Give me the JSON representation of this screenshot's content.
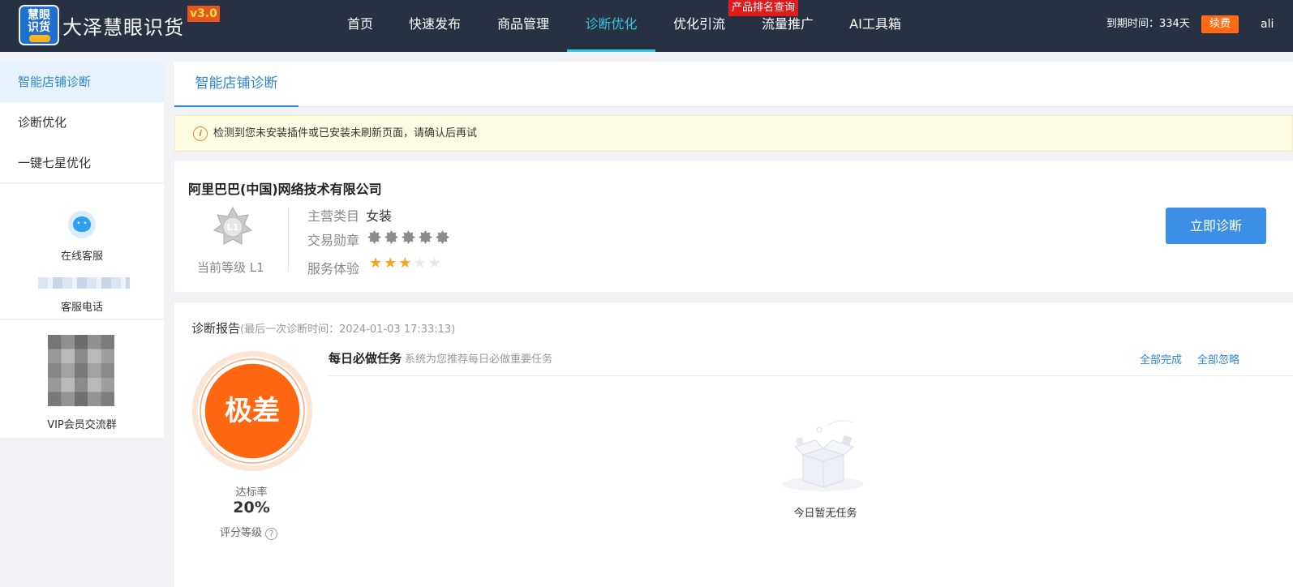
{
  "brand": {
    "logo_line1": "慧眼",
    "logo_line2": "识货",
    "name": "大泽慧眼识货",
    "version": "v3.0"
  },
  "nav": {
    "items": [
      "首页",
      "快速发布",
      "商品管理",
      "诊断优化",
      "优化引流",
      "流量推广",
      "AI工具箱"
    ],
    "active": "诊断优化",
    "hot_tag": "产品排名查询"
  },
  "account": {
    "expire": "到期时间：334天",
    "renew": "续费",
    "user": "ali"
  },
  "sidebar": {
    "items": [
      "智能店铺诊断",
      "诊断优化",
      "一键七星优化"
    ],
    "online_service": "在线客服",
    "service_phone": "客服电话",
    "vip_group": "VIP会员交流群"
  },
  "tab": {
    "label": "智能店铺诊断"
  },
  "alert": {
    "icon": "i",
    "text": "检测到您未安装插件或已安装未刷新页面，请确认后再试"
  },
  "shop": {
    "name": "阿里巴巴(中国)网络技术有限公司",
    "level_badge": "L1",
    "level_text": "当前等级 L1",
    "category_label": "主营类目",
    "category_value": "女装",
    "medal_label": "交易勋章",
    "medal_count": 5,
    "service_label": "服务体验",
    "service_stars": 3,
    "service_stars_max": 5,
    "diagnose_button": "立即诊断"
  },
  "report": {
    "title": "诊断报告",
    "subtitle": "(最后一次诊断时间：2024-01-03 17:33:13)",
    "score_word": "极差",
    "rate_label": "达标率",
    "rate_value": "20%",
    "grade_label": "评分等级",
    "help_icon": "?"
  },
  "tasks": {
    "title": "每日必做任务",
    "subtitle": "系统为您推荐每日必做重要任务",
    "complete_all": "全部完成",
    "ignore_all": "全部忽略",
    "empty_text": "今日暂无任务"
  },
  "colors": {
    "nav_bg": "#283142",
    "accent": "#2f86d8",
    "nav_active": "#38c5e0",
    "score": "#ff6610",
    "renew": "#ff6a13",
    "hot_tag": "#e01b1b"
  }
}
